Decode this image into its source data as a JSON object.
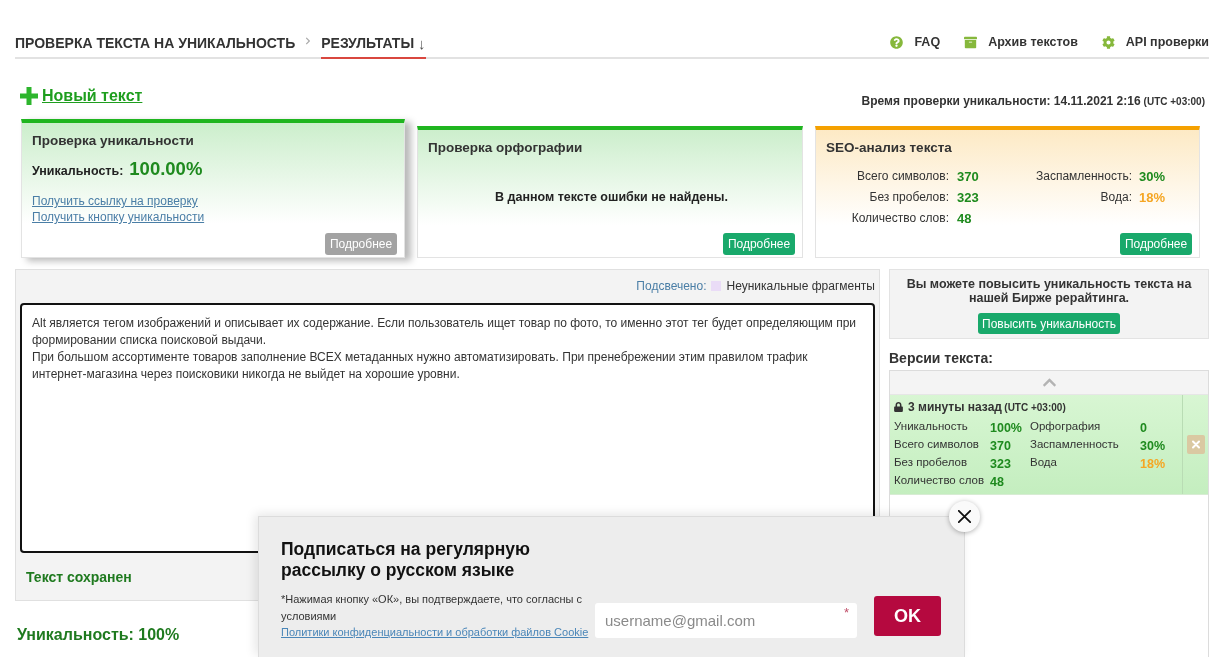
{
  "nav": {
    "tabs": [
      {
        "label": "ПРОВЕРКА ТЕКСТА НА УНИКАЛЬНОСТЬ",
        "selected": false
      },
      {
        "label": "РЕЗУЛЬТАТЫ",
        "marker": "↓",
        "selected": true
      }
    ],
    "links": [
      {
        "kind": "help",
        "label": "FAQ"
      },
      {
        "kind": "archive",
        "label": "Архив текстов"
      },
      {
        "kind": "settings",
        "label": "API проверки"
      }
    ]
  },
  "new_text_link": "Новый текст",
  "check_time": {
    "label": "Время проверки уникальности: 14.11.2021 2:16",
    "timezone": "(UTC +03:00)"
  },
  "cards": [
    {
      "kind": "uniqueness",
      "title": "Проверка уникальности",
      "selected": true,
      "color": "#1fb51f",
      "label": "Уникальность:",
      "value": "100.00%",
      "links": [
        "Получить ссылку на проверку",
        "Получить кнопку уникальности"
      ],
      "button": "Подробнее"
    },
    {
      "kind": "spelling",
      "title": "Проверка орфографии",
      "selected": false,
      "color": "#1fb51f",
      "message": "В данном тексте ошибки не найдены.",
      "button": "Подробнее"
    },
    {
      "kind": "seo",
      "title": "SEO-анализ текста",
      "selected": false,
      "color": "#f5a100",
      "stat_columns": [
        [
          {
            "label": "Всего символов:",
            "value": "370",
            "color": "#1e8a1e"
          },
          {
            "label": "Без пробелов:",
            "value": "323",
            "color": "#1e8a1e"
          },
          {
            "label": "Количество слов:",
            "value": "48",
            "color": "#1e8a1e"
          }
        ],
        [
          {
            "label": "Заспамленность:",
            "value": "30%",
            "color": "#1e8a1e"
          },
          {
            "label": "Вода:",
            "value": "18%",
            "color": "#f5a623"
          }
        ]
      ],
      "button": "Подробнее"
    }
  ],
  "editor": {
    "legend_label": "Подсвечено:",
    "legend_item": "Неуникальные фрагменты",
    "paragraphs": [
      "Alt является тегом изображений и описывает их содержание. Если пользователь ищет товар по фото, то именно этот тег будет определяющим при формировании списка поисковой выдачи.",
      "При большом ассортименте товаров заполнение ВСЕХ метаданных нужно автоматизировать. При пренебрежении этим правилом трафик интернет-магазина через поисковики никогда не выйдет на хорошие уровни."
    ],
    "status": "Текст сохранен"
  },
  "result": "Уникальность: 100%",
  "promo": {
    "message": "Вы можете повысить уникальность текста на нашей Бирже рерайтинга.",
    "button": "Повысить уникальность"
  },
  "versions": {
    "title": "Версии текста:",
    "items": [
      {
        "time": "3 минуты назад",
        "timezone": "(UTC +03:00)",
        "locked": true,
        "selected": true,
        "stat_columns": [
          [
            {
              "label": "Уникальность",
              "value": "100%",
              "color": "#1e8a1e"
            },
            {
              "label": "Всего символов",
              "value": "370",
              "color": "#1e8a1e"
            },
            {
              "label": "Без пробелов",
              "value": "323",
              "color": "#1e8a1e"
            },
            {
              "label": "Количество слов",
              "value": "48",
              "color": "#1e8a1e"
            }
          ],
          [
            {
              "label": "Орфография",
              "value": "0",
              "color": "#1e8a1e"
            },
            {
              "label": "Заспамленность",
              "value": "30%",
              "color": "#1e8a1e"
            },
            {
              "label": "Вода",
              "value": "18%",
              "color": "#f5a623"
            }
          ]
        ]
      }
    ]
  },
  "subscribe_popup": {
    "title": "Подписаться на регулярную рассылку о русском языке",
    "consent": "*Нажимая кнопку «ОК», вы подтверждаете, что согласны с условиями",
    "consent_link": "Политики конфиденциальности и обработки файлов Cookie",
    "email_placeholder": "username@gmail.com",
    "required_mark": "*",
    "button": "OK"
  }
}
